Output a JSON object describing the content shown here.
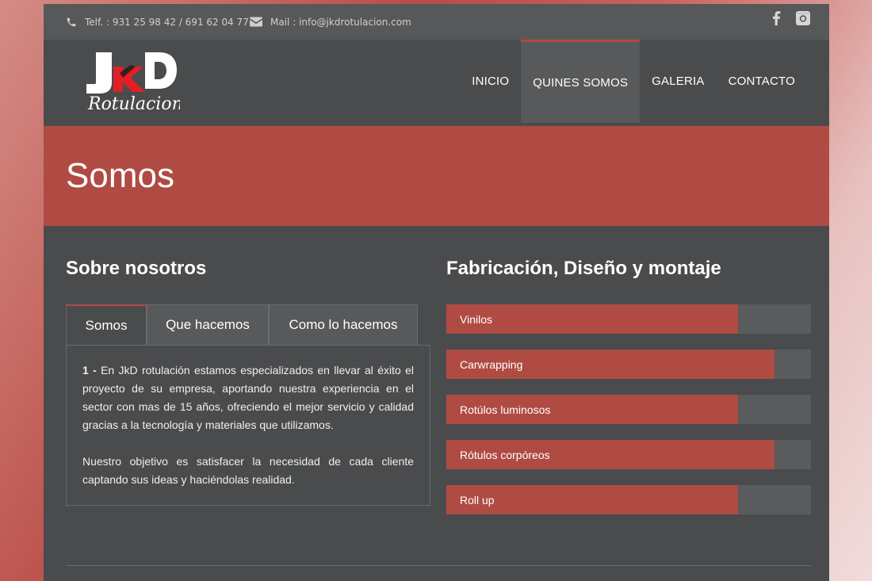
{
  "topbar": {
    "phone": "Telf. : 931 25 98 42 / 691 62 04 77",
    "mail": "Mail : info@jkdrotulacion.com",
    "icons": [
      "phone-icon",
      "mail-icon",
      "facebook-icon",
      "instagram-icon"
    ]
  },
  "logo": {
    "text_main": "JkD",
    "text_sub": "Rotulacion"
  },
  "nav": {
    "items": [
      {
        "label": "INICIO"
      },
      {
        "label": "QUINES SOMOS"
      },
      {
        "label": "GALERIA"
      },
      {
        "label": "CONTACTO"
      }
    ],
    "active_index": 1
  },
  "page_title": "Somos",
  "left": {
    "title": "Sobre nosotros",
    "tabs": [
      {
        "label": "Somos"
      },
      {
        "label": "Que hacemos"
      },
      {
        "label": "Como lo hacemos"
      }
    ],
    "active_tab": 0,
    "panel": {
      "p1_number": "1 -",
      "p1_text": "En JkD rotulación estamos especializados en llevar al éxito el proyecto de su empresa, aportando nuestra experiencia en el sector con mas de 15 años, ofreciendo el mejor servicio y calidad gracias a la tecnología y materiales que utilizamos.",
      "p2_text": "Nuestro objetivo es satisfacer la necesidad de cada cliente captando sus ideas y haciéndolas realidad."
    }
  },
  "right": {
    "title": "Fabricación, Diseño y montaje",
    "skills": [
      {
        "label": "Vinilos",
        "percent": 80
      },
      {
        "label": "Carwrapping",
        "percent": 90
      },
      {
        "label": "Rotúlos luminosos",
        "percent": 80
      },
      {
        "label": "Rótulos corpóreos",
        "percent": 90
      },
      {
        "label": "Roll up",
        "percent": 80
      }
    ]
  },
  "colors": {
    "accent": "#b04b43",
    "bg": "#4a4b4d",
    "bar_bg": "#5a5b5d"
  }
}
